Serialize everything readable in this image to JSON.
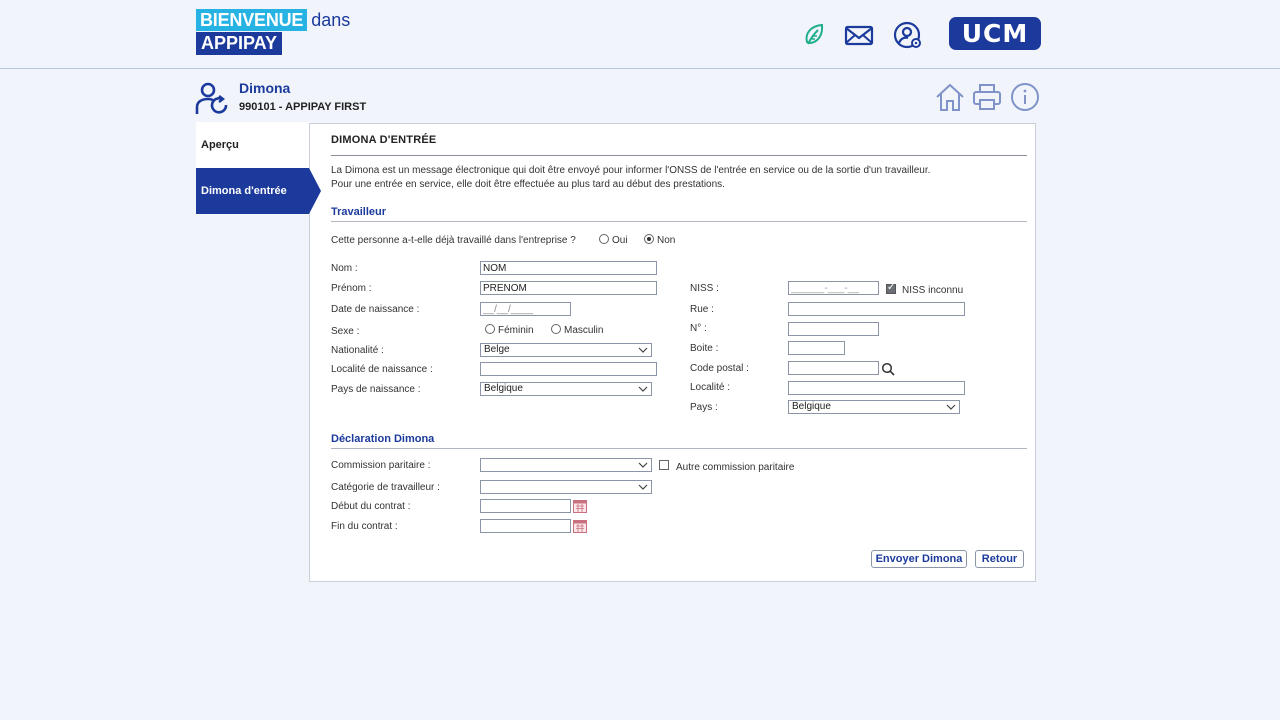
{
  "header": {
    "welcome": "BIENVENUE",
    "dans": "dans",
    "brand": "APPIPAY",
    "logo_text": "UCM",
    "icons": [
      "leaf-icon",
      "mail-icon",
      "user-settings-icon"
    ]
  },
  "employee": {
    "name": "Dimona",
    "subtitle": "990101 - APPIPAY FIRST"
  },
  "toolbar_icons": [
    "home-icon",
    "print-icon",
    "info-icon"
  ],
  "sidebar": {
    "items": [
      {
        "label": "Aperçu"
      },
      {
        "label": "Dimona d'entrée",
        "active": true
      }
    ]
  },
  "panel": {
    "title": "DIMONA D'ENTRÉE",
    "intro_line1": "La Dimona est un message électronique qui doit être envoyé pour informer l'ONSS de l'entrée en service ou de la sortie d'un travailleur.",
    "intro_line2": "Pour une entrée en service, elle doit être effectuée au plus tard au début des prestations."
  },
  "travailleur": {
    "section_title": "Travailleur",
    "question": "Cette personne a-t-elle déjà travaillé dans l'entreprise ?",
    "oui": "Oui",
    "non": "Non",
    "selected": "Non",
    "nom_label": "Nom :",
    "nom_value": "NOM",
    "prenom_label": "Prénom :",
    "prenom_value": "PRENOM",
    "naissance_label": "Date de naissance :",
    "naissance_value": "__/__/____",
    "sexe_label": "Sexe :",
    "feminin": "Féminin",
    "masculin": "Masculin",
    "nationalite_label": "Nationalité :",
    "nationalite_value": "Belge",
    "localite_naissance_label": "Localité de naissance :",
    "pays_naissance_label": "Pays de naissance :",
    "pays_naissance_value": "Belgique",
    "niss_label": "NISS :",
    "niss_value": "______-___-__",
    "niss_inconnu": "NISS inconnu",
    "rue_label": "Rue :",
    "numero_label": "N° :",
    "boite_label": "Boite :",
    "code_postal_label": "Code postal :",
    "localite_label": "Localité :",
    "pays_label": "Pays :",
    "pays_value": "Belgique"
  },
  "declaration": {
    "section_title": "Déclaration Dimona",
    "commission_label": "Commission paritaire :",
    "autre_commission": "Autre commission paritaire",
    "categorie_label": "Catégorie de travailleur :",
    "debut_label": "Début du contrat :",
    "fin_label": "Fin du contrat :"
  },
  "buttons": {
    "envoyer": "Envoyer Dimona",
    "retour": "Retour"
  },
  "colors": {
    "navy": "#1b3a9c",
    "cyan": "#26b3e3",
    "leaf_green": "#1fae8c"
  }
}
